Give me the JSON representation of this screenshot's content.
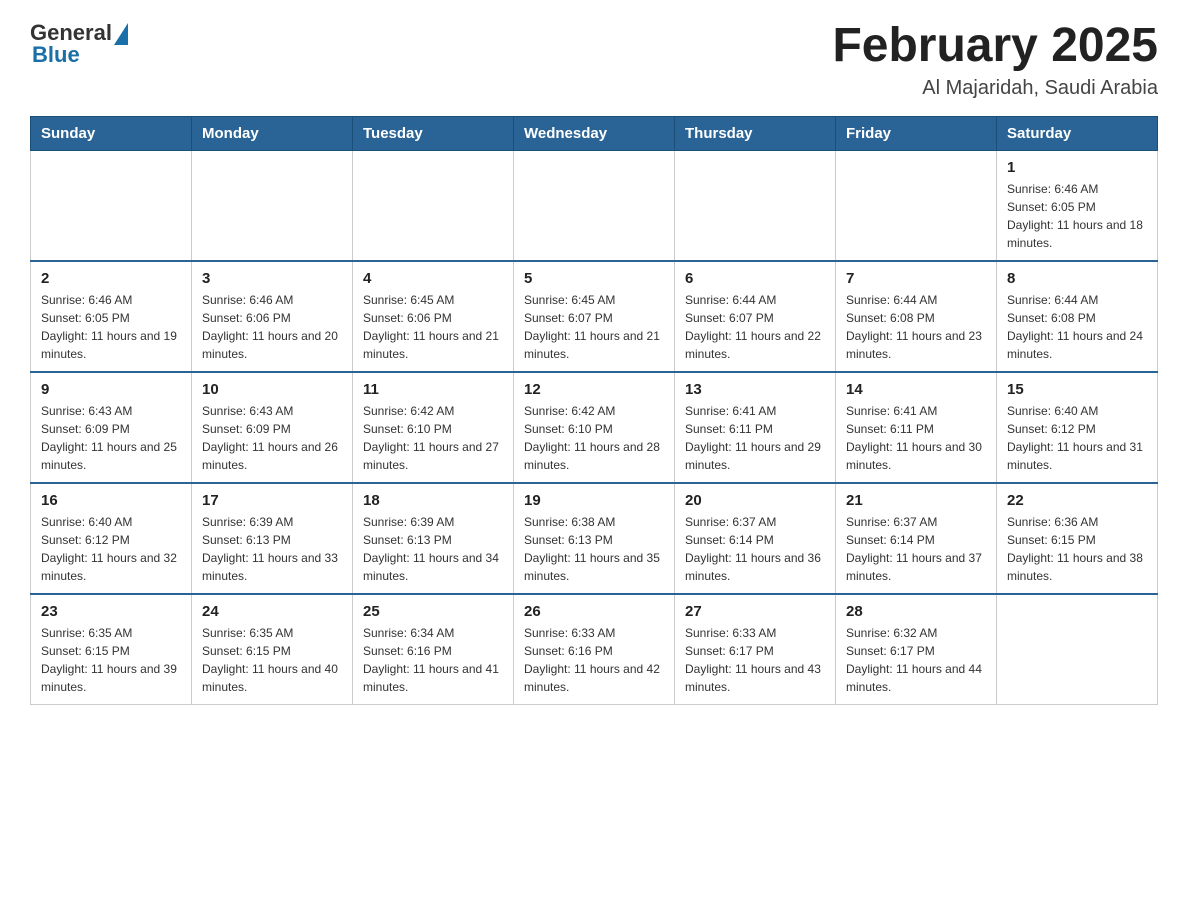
{
  "header": {
    "logo": {
      "general": "General",
      "blue": "Blue"
    },
    "title": "February 2025",
    "location": "Al Majaridah, Saudi Arabia"
  },
  "weekdays": [
    "Sunday",
    "Monday",
    "Tuesday",
    "Wednesday",
    "Thursday",
    "Friday",
    "Saturday"
  ],
  "weeks": [
    [
      {
        "day": "",
        "sunrise": "",
        "sunset": "",
        "daylight": ""
      },
      {
        "day": "",
        "sunrise": "",
        "sunset": "",
        "daylight": ""
      },
      {
        "day": "",
        "sunrise": "",
        "sunset": "",
        "daylight": ""
      },
      {
        "day": "",
        "sunrise": "",
        "sunset": "",
        "daylight": ""
      },
      {
        "day": "",
        "sunrise": "",
        "sunset": "",
        "daylight": ""
      },
      {
        "day": "",
        "sunrise": "",
        "sunset": "",
        "daylight": ""
      },
      {
        "day": "1",
        "sunrise": "Sunrise: 6:46 AM",
        "sunset": "Sunset: 6:05 PM",
        "daylight": "Daylight: 11 hours and 18 minutes."
      }
    ],
    [
      {
        "day": "2",
        "sunrise": "Sunrise: 6:46 AM",
        "sunset": "Sunset: 6:05 PM",
        "daylight": "Daylight: 11 hours and 19 minutes."
      },
      {
        "day": "3",
        "sunrise": "Sunrise: 6:46 AM",
        "sunset": "Sunset: 6:06 PM",
        "daylight": "Daylight: 11 hours and 20 minutes."
      },
      {
        "day": "4",
        "sunrise": "Sunrise: 6:45 AM",
        "sunset": "Sunset: 6:06 PM",
        "daylight": "Daylight: 11 hours and 21 minutes."
      },
      {
        "day": "5",
        "sunrise": "Sunrise: 6:45 AM",
        "sunset": "Sunset: 6:07 PM",
        "daylight": "Daylight: 11 hours and 21 minutes."
      },
      {
        "day": "6",
        "sunrise": "Sunrise: 6:44 AM",
        "sunset": "Sunset: 6:07 PM",
        "daylight": "Daylight: 11 hours and 22 minutes."
      },
      {
        "day": "7",
        "sunrise": "Sunrise: 6:44 AM",
        "sunset": "Sunset: 6:08 PM",
        "daylight": "Daylight: 11 hours and 23 minutes."
      },
      {
        "day": "8",
        "sunrise": "Sunrise: 6:44 AM",
        "sunset": "Sunset: 6:08 PM",
        "daylight": "Daylight: 11 hours and 24 minutes."
      }
    ],
    [
      {
        "day": "9",
        "sunrise": "Sunrise: 6:43 AM",
        "sunset": "Sunset: 6:09 PM",
        "daylight": "Daylight: 11 hours and 25 minutes."
      },
      {
        "day": "10",
        "sunrise": "Sunrise: 6:43 AM",
        "sunset": "Sunset: 6:09 PM",
        "daylight": "Daylight: 11 hours and 26 minutes."
      },
      {
        "day": "11",
        "sunrise": "Sunrise: 6:42 AM",
        "sunset": "Sunset: 6:10 PM",
        "daylight": "Daylight: 11 hours and 27 minutes."
      },
      {
        "day": "12",
        "sunrise": "Sunrise: 6:42 AM",
        "sunset": "Sunset: 6:10 PM",
        "daylight": "Daylight: 11 hours and 28 minutes."
      },
      {
        "day": "13",
        "sunrise": "Sunrise: 6:41 AM",
        "sunset": "Sunset: 6:11 PM",
        "daylight": "Daylight: 11 hours and 29 minutes."
      },
      {
        "day": "14",
        "sunrise": "Sunrise: 6:41 AM",
        "sunset": "Sunset: 6:11 PM",
        "daylight": "Daylight: 11 hours and 30 minutes."
      },
      {
        "day": "15",
        "sunrise": "Sunrise: 6:40 AM",
        "sunset": "Sunset: 6:12 PM",
        "daylight": "Daylight: 11 hours and 31 minutes."
      }
    ],
    [
      {
        "day": "16",
        "sunrise": "Sunrise: 6:40 AM",
        "sunset": "Sunset: 6:12 PM",
        "daylight": "Daylight: 11 hours and 32 minutes."
      },
      {
        "day": "17",
        "sunrise": "Sunrise: 6:39 AM",
        "sunset": "Sunset: 6:13 PM",
        "daylight": "Daylight: 11 hours and 33 minutes."
      },
      {
        "day": "18",
        "sunrise": "Sunrise: 6:39 AM",
        "sunset": "Sunset: 6:13 PM",
        "daylight": "Daylight: 11 hours and 34 minutes."
      },
      {
        "day": "19",
        "sunrise": "Sunrise: 6:38 AM",
        "sunset": "Sunset: 6:13 PM",
        "daylight": "Daylight: 11 hours and 35 minutes."
      },
      {
        "day": "20",
        "sunrise": "Sunrise: 6:37 AM",
        "sunset": "Sunset: 6:14 PM",
        "daylight": "Daylight: 11 hours and 36 minutes."
      },
      {
        "day": "21",
        "sunrise": "Sunrise: 6:37 AM",
        "sunset": "Sunset: 6:14 PM",
        "daylight": "Daylight: 11 hours and 37 minutes."
      },
      {
        "day": "22",
        "sunrise": "Sunrise: 6:36 AM",
        "sunset": "Sunset: 6:15 PM",
        "daylight": "Daylight: 11 hours and 38 minutes."
      }
    ],
    [
      {
        "day": "23",
        "sunrise": "Sunrise: 6:35 AM",
        "sunset": "Sunset: 6:15 PM",
        "daylight": "Daylight: 11 hours and 39 minutes."
      },
      {
        "day": "24",
        "sunrise": "Sunrise: 6:35 AM",
        "sunset": "Sunset: 6:15 PM",
        "daylight": "Daylight: 11 hours and 40 minutes."
      },
      {
        "day": "25",
        "sunrise": "Sunrise: 6:34 AM",
        "sunset": "Sunset: 6:16 PM",
        "daylight": "Daylight: 11 hours and 41 minutes."
      },
      {
        "day": "26",
        "sunrise": "Sunrise: 6:33 AM",
        "sunset": "Sunset: 6:16 PM",
        "daylight": "Daylight: 11 hours and 42 minutes."
      },
      {
        "day": "27",
        "sunrise": "Sunrise: 6:33 AM",
        "sunset": "Sunset: 6:17 PM",
        "daylight": "Daylight: 11 hours and 43 minutes."
      },
      {
        "day": "28",
        "sunrise": "Sunrise: 6:32 AM",
        "sunset": "Sunset: 6:17 PM",
        "daylight": "Daylight: 11 hours and 44 minutes."
      },
      {
        "day": "",
        "sunrise": "",
        "sunset": "",
        "daylight": ""
      }
    ]
  ]
}
